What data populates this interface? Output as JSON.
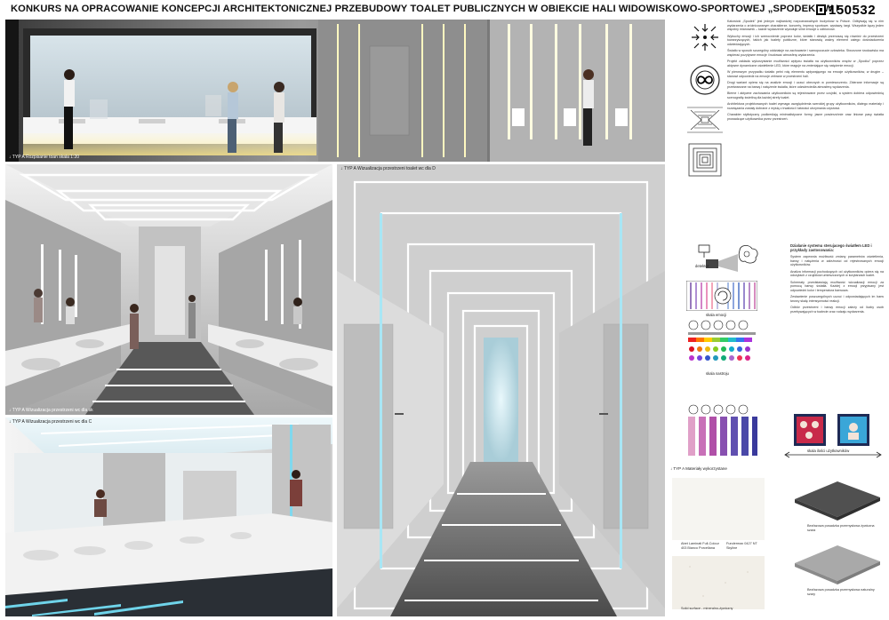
{
  "header": {
    "title": "KONKURS NA OPRACOWANIE KONCEPCJI ARCHITEKTONICZNEJ PRZEBUDOWY TOALET PUBLICZNYCH W OBIEKCIE HALI WIDOWISKOWO-SPORTOWEJ „SPODEK” W KATOWICACH",
    "code": "150532"
  },
  "panels": {
    "p1_caption": "↓ TYP A Rozpisanie toan skala 1:20",
    "p2_caption": "↓ TYP A Wizualizacja przestrzeni wc dla sk",
    "p3_caption": "↓ TYP A Wizualizacja przestrzeni wc dla C",
    "p4_caption": "↓ TYP A Wizualizacja przestrzeni toalet wc dla D"
  },
  "text_right": [
    "Katowicki „Spodek” jest jednym najbardziej rozpoznawalnych budynków w Polsce. Odbywają się w nim wydarzenia o zróżnicowanym charakterze, koncerty, imprezy sportowe, wystawy, targi. Wszystkie łączy jeden wspólny mianownik – każde wydarzenie wywołuje silne emocje u odbiorców.",
    "Wybuchy emocji i ich wzmocnienie poprzez kolor, światło i dźwięk przenoszą się również do przestrzeni towarzyszących, takich jak toalety publiczne, które stanowią ważny element całego doświadczenia odwiedzających.",
    "Światło w sposób szczególny oddziałuje na zachowanie i samopoczucie człowieka. Stworzone środowisko ma wspierać pozytywne emocje i budować atmosferę wydarzenia.",
    "Projekt zakłada wykorzystanie możliwości wpływu światła na użytkowników wnętrz w „Spodku” poprzez aktywne dynamiczne oświetlenie LED, które reaguje na zmieniające się natężenie emocji.",
    "W pierwszym przypadku światło pełni rolę elementu wpływającego na emocje użytkowników, w drugim – stanowi odpowiedź na emocje zebrane w przestrzeni hali.",
    "Drugi wariant opiera się na analizie emocji i uczuć obecnych w pomieszczeniu. Zbierane informacje są przetwarzane na barwę i natężenie światła, które odzwierciedla atmosferę wydarzenia.",
    "Bierne i aktywne zachowania użytkowników są rejestrowane przez czujniki, a system dobiera odpowiednią scenografię świetlną dla każdej strefy toalet.",
    "Architektura projektowanych toalet wymaga uwzględnienia szerokiej grupy użytkowników, dlatego materiały i rozwiązania zostały dobrane z myślą o trwałości i łatwości utrzymania czystości.",
    "Charakter stylistyczny podkreślają minimalistyczne formy, jasne powierzchnie oraz liniowe pasy światła prowadzące użytkownika przez przestrzeń."
  ],
  "led_section": {
    "heading": "Działanie systemu sterujacego światłem LED i przykłady zastosowania:",
    "paragraphs": [
      "System zapewnia możliwość zmiany parametrów oświetlenia, barwy i natężenia w zależności od rejestrowanych emocji użytkowników.",
      "Analiza informacji pochodzących od użytkowników opiera się na odczytach z czujników umieszczonych w korytarzach toalet.",
      "Schematy przedstawiają możliwość wizualizacji emocji za pomocą barwy światła. Każdej z emocji przypisany jest odpowiedni kolor i temperatura barwowa.",
      "Zestawienie poszczególnych uczuć i odpowiadających im barw tworzy skalę intensywności reakcji.",
      "Odbiór przestrzeni i barwy emocji zależy od liczby osób przebywających w toalecie oraz rodzaju wydarzenia."
    ]
  },
  "diagram_labels": {
    "detector": "detektor",
    "emotion_scale": "skala emocji",
    "mood_scale": "skala nastroju",
    "users_scale": "skala ilości użytkowników"
  },
  "materials": {
    "title": "↓ TYP A Materiały wykorzystane",
    "laminate": "Abet Laminati Full-Colour 403 Bianco Porcellana",
    "fundermax": "Fundermax 0427 NT Skyline",
    "solid_surface": "Solid surface - mineralno-żywiczny",
    "floor1": "Bezfazowa posadzka przemysłowa żywiczna szara",
    "floor2": "Bezfazowa posadzka przemysłowa naturalny szary"
  },
  "colors": {
    "accent_cyan": "#6fd4ea",
    "led_white": "#ffffff"
  }
}
